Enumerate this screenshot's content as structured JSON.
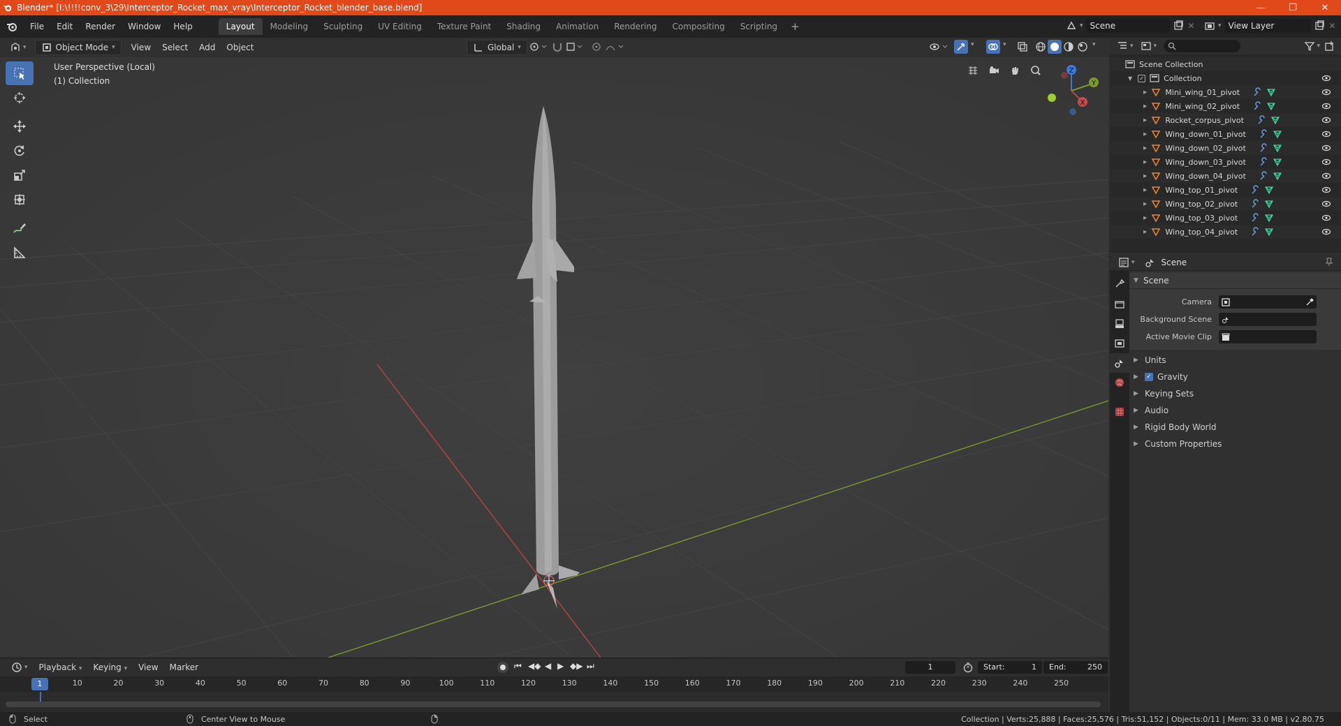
{
  "window": {
    "title": "Blender* [I:\\!!!!conv_3\\29\\Interceptor_Rocket_max_vray\\Interceptor_Rocket_blender_base.blend]",
    "controls": [
      "minimize",
      "maximize",
      "close"
    ]
  },
  "menu": {
    "items": [
      "File",
      "Edit",
      "Render",
      "Window",
      "Help"
    ]
  },
  "workspaces": {
    "tabs": [
      "Layout",
      "Modeling",
      "Sculpting",
      "UV Editing",
      "Texture Paint",
      "Shading",
      "Animation",
      "Rendering",
      "Compositing",
      "Scripting"
    ],
    "active": "Layout",
    "add_label": "+"
  },
  "scene_selector": {
    "value": "Scene"
  },
  "view_layer_selector": {
    "value": "View Layer"
  },
  "viewport_header": {
    "mode": "Object Mode",
    "menus": [
      "View",
      "Select",
      "Add",
      "Object"
    ],
    "orientation": "Global"
  },
  "viewport": {
    "perspective_label": "User Perspective (Local)",
    "collection_label": "(1) Collection",
    "axis_colors": {
      "x": "#b84444",
      "y": "#7a9a2a",
      "z": "#3d7bd6"
    },
    "gizmo": {
      "x": "X",
      "y": "Y",
      "z": "Z"
    }
  },
  "timeline": {
    "menus": [
      "Playback",
      "Keying",
      "View",
      "Marker"
    ],
    "current_frame": "1",
    "start_label": "Start:",
    "start_value": "1",
    "end_label": "End:",
    "end_value": "250",
    "ticks": [
      "1",
      "10",
      "20",
      "30",
      "40",
      "50",
      "60",
      "70",
      "80",
      "90",
      "100",
      "110",
      "120",
      "130",
      "140",
      "150",
      "160",
      "170",
      "180",
      "190",
      "200",
      "210",
      "220",
      "230",
      "240",
      "250"
    ]
  },
  "statusbar": {
    "left_action": "Select",
    "middle_action": "Center View to Mouse",
    "stats": "Collection | Verts:25,888 | Faces:25,576 | Tris:51,152 | Objects:0/11 | Mem: 33.0 MB | v2.80.75"
  },
  "outliner": {
    "scene_collection": "Scene Collection",
    "collection": "Collection",
    "objects": [
      "Mini_wing_01_pivot",
      "Mini_wing_02_pivot",
      "Rocket_corpus_pivot",
      "Wing_down_01_pivot",
      "Wing_down_02_pivot",
      "Wing_down_03_pivot",
      "Wing_down_04_pivot",
      "Wing_top_01_pivot",
      "Wing_top_02_pivot",
      "Wing_top_03_pivot",
      "Wing_top_04_pivot"
    ]
  },
  "properties": {
    "header_title": "Scene",
    "panel_title": "Scene",
    "fields": {
      "camera_label": "Camera",
      "background_scene_label": "Background Scene",
      "active_movie_clip_label": "Active Movie Clip"
    },
    "subpanels": [
      "Units",
      "Gravity",
      "Keying Sets",
      "Audio",
      "Rigid Body World",
      "Custom Properties"
    ]
  },
  "colors": {
    "accent": "#4772b3",
    "titlebar": "#e2491a",
    "object_icon": "#e8883a",
    "mesh_icon": "#3fd6a1",
    "modifier_icon": "#6f9bd8"
  }
}
